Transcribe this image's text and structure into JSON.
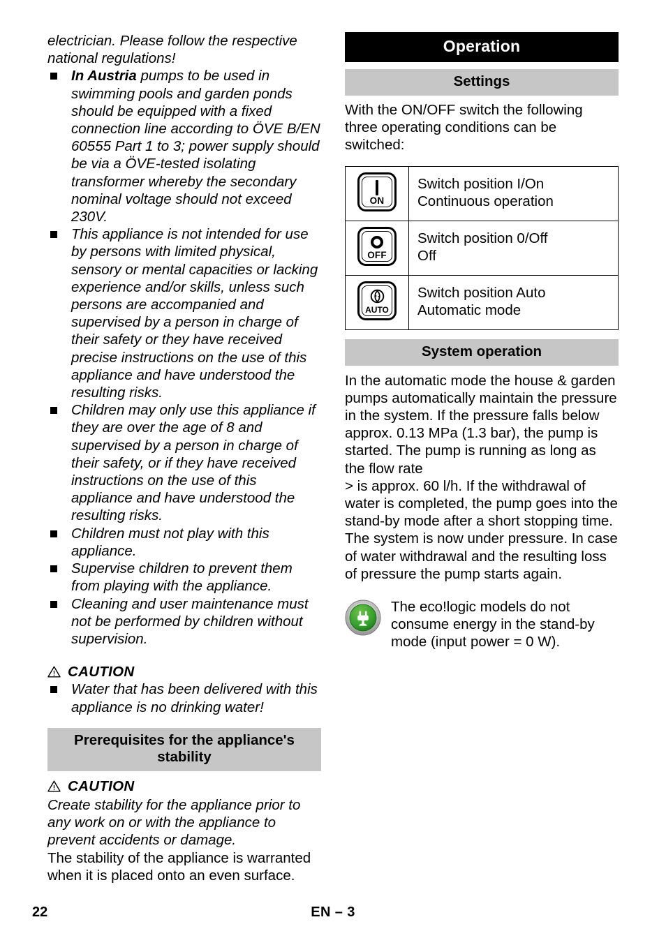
{
  "left_column": {
    "intro_continuation": "electrician. Please follow the respective national regulations!",
    "bullets": [
      {
        "lead": "In Austria",
        "text": " pumps to be used in swimming pools and garden ponds should be equipped with a fixed connection line according to ÖVE B/EN 60555 Part 1 to 3; power supply should be via a ÖVE-tested isolating transformer whereby the secondary nominal voltage should not exceed 230V."
      },
      {
        "lead": "",
        "text": "This appliance is not intended for use by persons with limited physical, sensory or mental capacities or lacking experience and/or skills, unless such persons are accompanied and supervised by a person in charge of their safety or they have received precise instructions on the use of this appliance and have understood the resulting risks."
      },
      {
        "lead": "",
        "text": "Children may only use this appliance if they are over the age of 8 and supervised by a person in charge of their safety, or if they have received instructions on the use of this appliance and have understood the resulting risks."
      },
      {
        "lead": "",
        "text": "Children must not play with this appliance."
      },
      {
        "lead": "",
        "text": "Supervise children to prevent them from playing with the appliance."
      },
      {
        "lead": "",
        "text": "Cleaning and user maintenance must not be performed by children without supervision."
      }
    ],
    "caution_1": {
      "label": "CAUTION",
      "bullet": "Water that has been delivered with this appliance is no drinking water!"
    },
    "stability_heading": "Prerequisites for the appliance's stability",
    "caution_2": {
      "label": "CAUTION",
      "italic_text": "Create stability for the appliance prior to any work on or with the appliance to prevent accidents or damage.",
      "roman_text": "The stability of the appliance is warranted when it is placed onto an even surface."
    }
  },
  "right_column": {
    "chapter_title": "Operation",
    "settings_heading": "Settings",
    "settings_intro": "With the ON/OFF switch the following three operating conditions can be switched:",
    "switch_table": [
      {
        "icon_label": "ON",
        "icon_glyph": "bar-I",
        "icon_name": "switch-on-icon",
        "line1": "Switch position I/On",
        "line2": "Continuous operation"
      },
      {
        "icon_label": "OFF",
        "icon_glyph": "ring-O",
        "icon_name": "switch-off-icon",
        "line1": "Switch position 0/Off",
        "line2": "Off"
      },
      {
        "icon_label": "AUTO",
        "icon_glyph": "cycle",
        "icon_name": "switch-auto-icon",
        "line1": "Switch position Auto",
        "line2": "Automatic mode"
      }
    ],
    "system_heading": "System operation",
    "system_paragraph_1": "In the automatic mode the house & garden pumps automatically maintain the pressure in the system. If the pressure falls below approx. 0.13 MPa (1.3 bar), the pump is started. The pump is running as long as the flow rate",
    "system_paragraph_2": "> is approx. 60 l/h. If the withdrawal of water is completed, the pump goes into the stand-by mode after a short stopping time. The system is now under pressure. In case of water withdrawal and the resulting loss of pressure the pump starts again.",
    "eco_note": "The eco!logic models do not consume energy in the stand-by mode (input power = 0 W).",
    "eco_badge_name": "ecologic-plug-badge-icon"
  },
  "footer": {
    "page_number": "22",
    "section_marker": "EN – 3"
  },
  "colors": {
    "heading_bar_gray": "#c6c6c6",
    "chapter_bar_black": "#000000",
    "eco_green": "#33a02c",
    "eco_ring_silver": "#b8b8b8",
    "text": "#000000",
    "page_background": "#ffffff"
  }
}
